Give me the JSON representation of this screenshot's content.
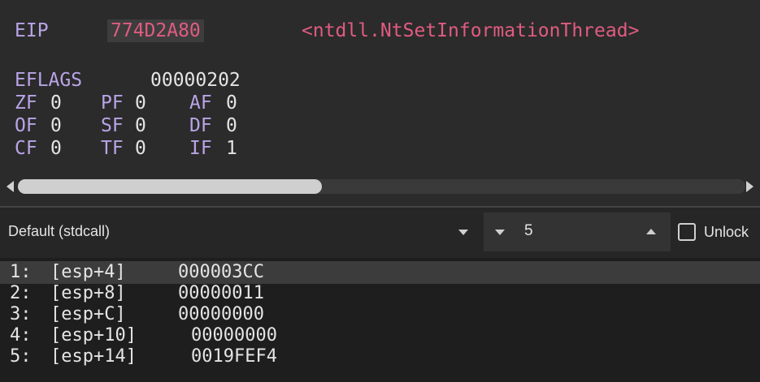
{
  "registers": {
    "eip": {
      "name": "EIP",
      "value": "774D2A80",
      "label": "<ntdll.NtSetInformationThread>"
    },
    "eflags": {
      "name": "EFLAGS",
      "value": "00000202"
    },
    "flags": [
      [
        {
          "name": "ZF",
          "value": "0"
        },
        {
          "name": "PF",
          "value": "0"
        },
        {
          "name": "AF",
          "value": "0"
        }
      ],
      [
        {
          "name": "OF",
          "value": "0"
        },
        {
          "name": "SF",
          "value": "0"
        },
        {
          "name": "DF",
          "value": "0"
        }
      ],
      [
        {
          "name": "CF",
          "value": "0"
        },
        {
          "name": "TF",
          "value": "0"
        },
        {
          "name": "IF",
          "value": "1"
        }
      ]
    ]
  },
  "callstack": {
    "convention": "Default (stdcall)",
    "arg_count": "5",
    "unlock_label": "Unlock"
  },
  "stack_args": [
    {
      "index": "1:",
      "offset": "[esp+4]",
      "value": "000003CC"
    },
    {
      "index": "2:",
      "offset": "[esp+8]",
      "value": "00000011"
    },
    {
      "index": "3:",
      "offset": "[esp+C]",
      "value": "00000000"
    },
    {
      "index": "4:",
      "offset": "[esp+10]",
      "value": "00000000"
    },
    {
      "index": "5:",
      "offset": "[esp+14]",
      "value": "0019FEF4"
    }
  ],
  "colors": {
    "register_name": "#b9a4e6",
    "eip_highlight": "#e05c80",
    "text": "#e4e4e4",
    "background": "#2b2b2b"
  }
}
